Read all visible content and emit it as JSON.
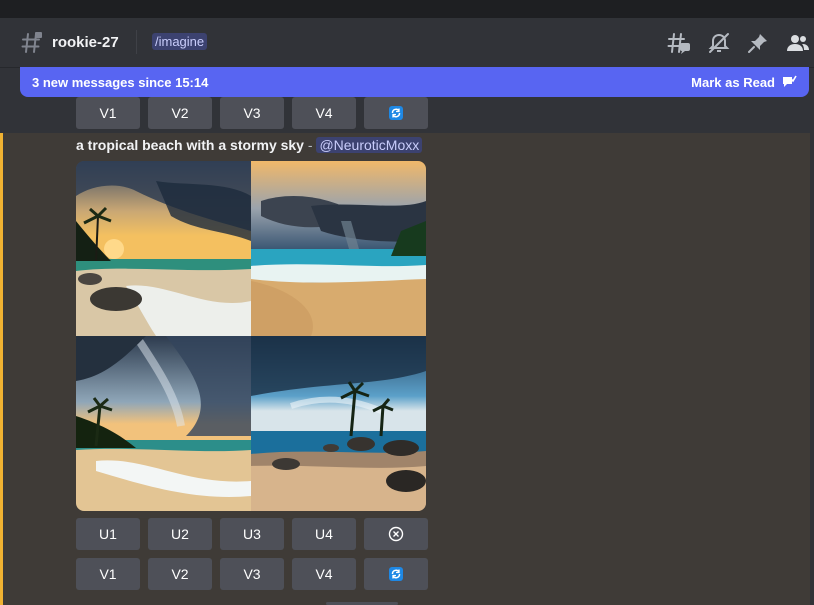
{
  "header": {
    "channel": "rookie-27",
    "topic": "/imagine"
  },
  "banner": {
    "text": "3 new messages since 15:14",
    "action": "Mark as Read"
  },
  "previous_message": {
    "variation_buttons": [
      "V1",
      "V2",
      "V3",
      "V4"
    ]
  },
  "message": {
    "prompt": "a tropical beach with a stormy sky",
    "separator": " - ",
    "mention": "@NeuroticMoxx",
    "upscale_buttons": [
      "U1",
      "U2",
      "U3",
      "U4"
    ],
    "variation_buttons": [
      "V1",
      "V2",
      "V3",
      "V4"
    ]
  },
  "icons": {
    "channel": "hash-icon",
    "threads": "threads-icon",
    "mute": "bell-slash-icon",
    "pin": "pin-icon",
    "members": "members-icon",
    "mark_read": "mark-read-icon",
    "reroll": "refresh-icon",
    "cancel": "cancel-icon"
  },
  "colors": {
    "banner": "#5865f2",
    "highlight_border": "#f0b232",
    "button": "#4e5058",
    "refresh": "#1e88e5"
  }
}
